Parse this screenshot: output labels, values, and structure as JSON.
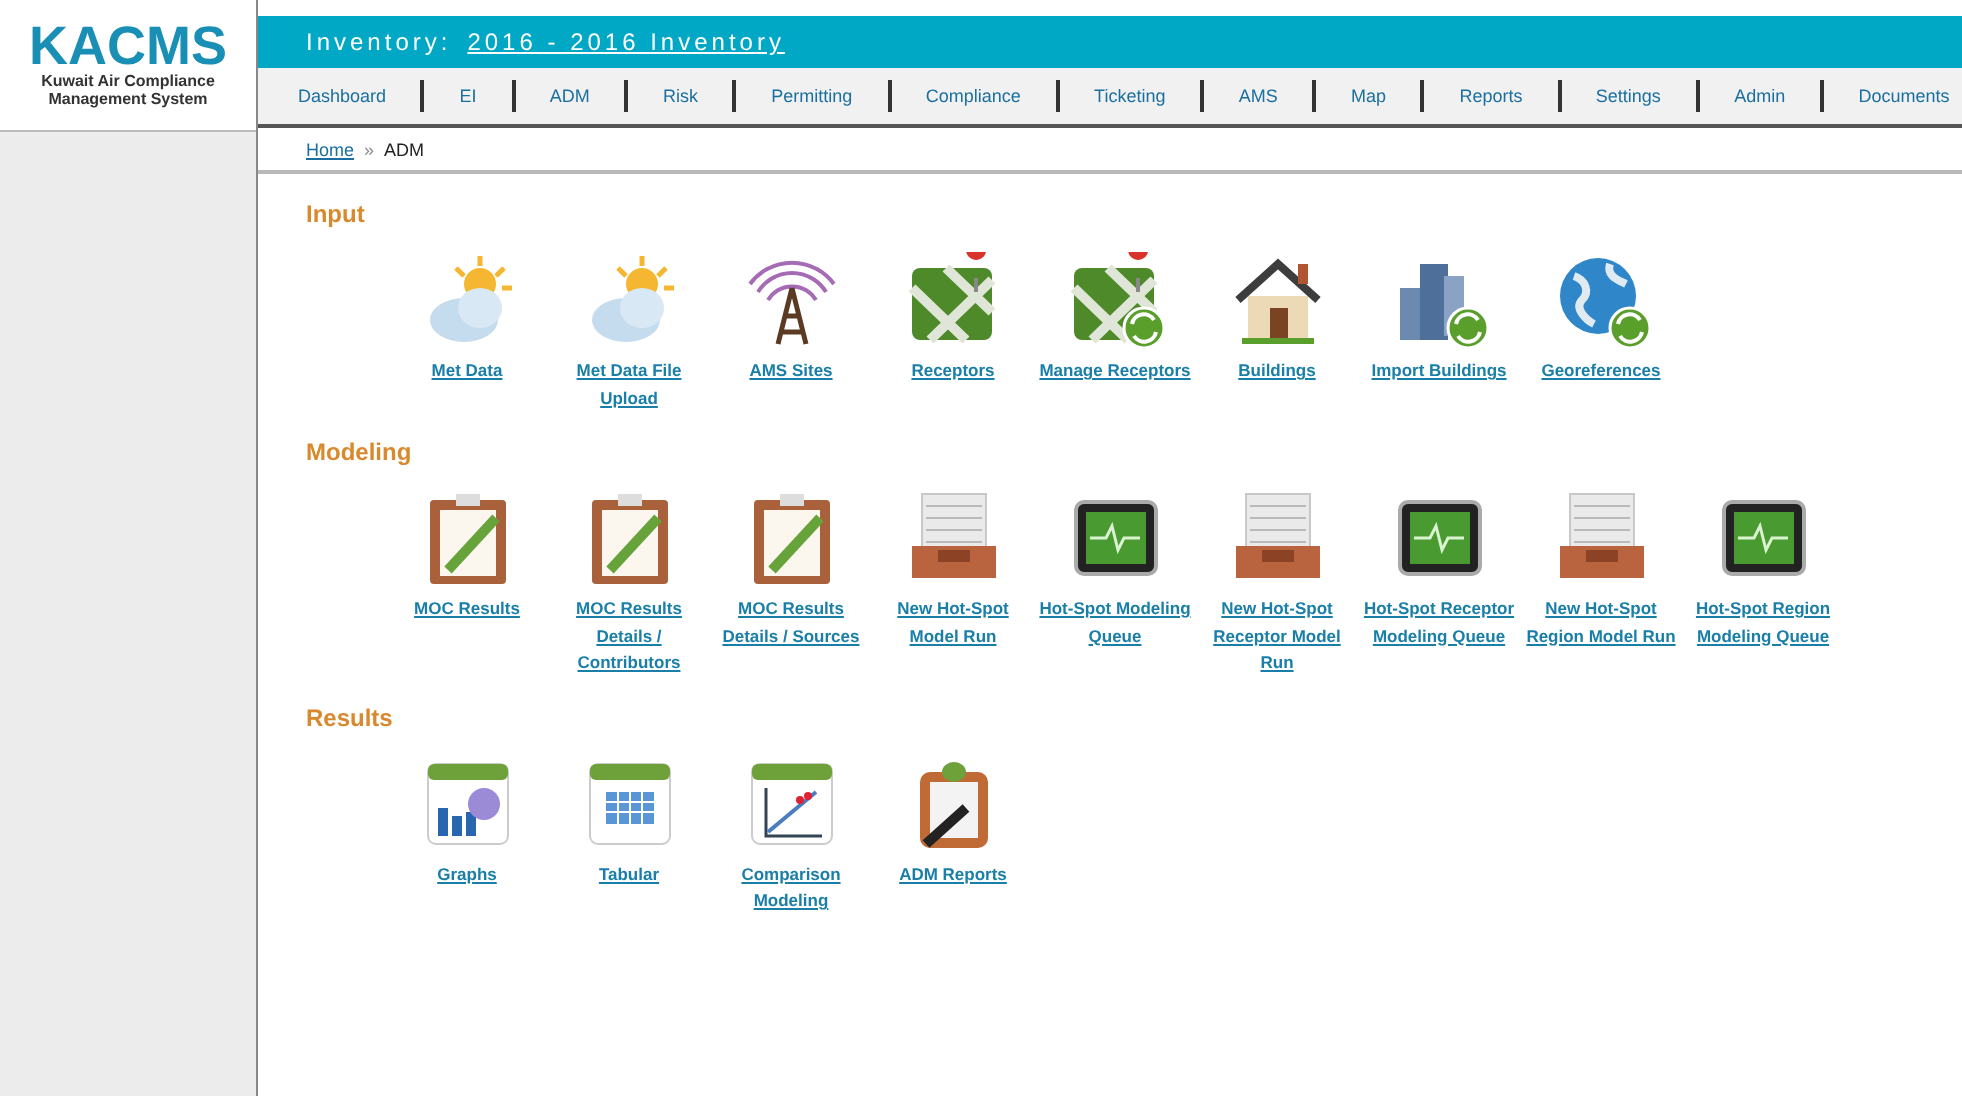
{
  "logo": {
    "title": "KACMS",
    "subtitle": "Kuwait Air Compliance Management System"
  },
  "inventory": {
    "label": "Inventory:",
    "value": "2016 - 2016 Inventory"
  },
  "nav": [
    {
      "label": "Dashboard"
    },
    {
      "label": "EI"
    },
    {
      "label": "ADM"
    },
    {
      "label": "Risk"
    },
    {
      "label": "Permitting"
    },
    {
      "label": "Compliance"
    },
    {
      "label": "Ticketing"
    },
    {
      "label": "AMS"
    },
    {
      "label": "Map"
    },
    {
      "label": "Reports"
    },
    {
      "label": "Settings"
    },
    {
      "label": "Admin"
    },
    {
      "label": "Documents"
    }
  ],
  "breadcrumb": {
    "link": "Home",
    "separator": "»",
    "current": "ADM"
  },
  "sections": [
    {
      "title": "Input",
      "items": [
        {
          "kind": "weather",
          "label": "Met Data"
        },
        {
          "kind": "weather",
          "label": "Met Data File Upload"
        },
        {
          "kind": "tower",
          "label": "AMS Sites"
        },
        {
          "kind": "map",
          "label": "Receptors"
        },
        {
          "kind": "map-sync",
          "label": "Manage Receptors"
        },
        {
          "kind": "house",
          "label": "Buildings"
        },
        {
          "kind": "buildings-sync",
          "label": "Import Buildings"
        },
        {
          "kind": "globe-sync",
          "label": "Georeferences"
        }
      ]
    },
    {
      "title": "Modeling",
      "items": [
        {
          "kind": "clipboard",
          "label": "MOC Results"
        },
        {
          "kind": "clipboard",
          "label": "MOC Results Details / Contributors"
        },
        {
          "kind": "clipboard",
          "label": "MOC Results Details / Sources"
        },
        {
          "kind": "tray",
          "label": "New Hot-Spot Model Run"
        },
        {
          "kind": "monitor",
          "label": "Hot-Spot Modeling Queue"
        },
        {
          "kind": "tray",
          "label": "New Hot-Spot Receptor Model Run"
        },
        {
          "kind": "monitor",
          "label": "Hot-Spot Receptor Modeling Queue"
        },
        {
          "kind": "tray",
          "label": "New Hot-Spot Region Model Run"
        },
        {
          "kind": "monitor",
          "label": "Hot-Spot Region Modeling Queue"
        }
      ]
    },
    {
      "title": "Results",
      "items": [
        {
          "kind": "graphs",
          "label": "Graphs"
        },
        {
          "kind": "table",
          "label": "Tabular"
        },
        {
          "kind": "scatter",
          "label": "Comparison Modeling"
        },
        {
          "kind": "report",
          "label": "ADM Reports"
        }
      ]
    }
  ]
}
